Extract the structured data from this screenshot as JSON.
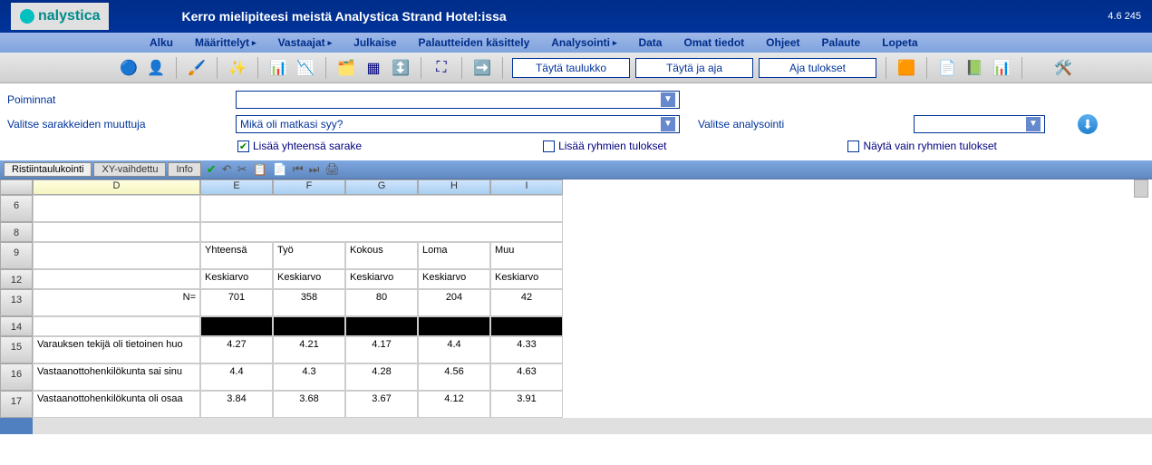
{
  "logo": "nalystica",
  "title": "Kerro mielipiteesi meistä Analystica Strand Hotel:issa",
  "version": "4.6 245",
  "menu": [
    "Alku",
    "Määrittelyt",
    "Vastaajat",
    "Julkaise",
    "Palautteiden käsittely",
    "Analysointi",
    "Data",
    "Omat tiedot",
    "Ohjeet",
    "Palaute",
    "Lopeta"
  ],
  "menu_has_arrow": [
    false,
    true,
    true,
    false,
    false,
    true,
    false,
    false,
    false,
    false,
    false
  ],
  "buttons": {
    "fill": "Täytä taulukko",
    "fillrun": "Täytä ja aja",
    "run": "Aja tulokset"
  },
  "filters": {
    "poiminnat_label": "Poiminnat",
    "poiminnat_value": "",
    "cols_label": "Valitse sarakkeiden muuttuja",
    "cols_value": "Mikä oli matkasi syy?",
    "analysis_label": "Valitse analysointi",
    "analysis_value": ""
  },
  "checks": {
    "total": "Lisää yhteensä sarake",
    "groups": "Lisää ryhmien tulokset",
    "only": "Näytä vain ryhmien tulokset"
  },
  "tabs": {
    "crosstab": "Ristiintaulukointi",
    "xy": "XY-vaihdettu",
    "info": "Info"
  },
  "sheet": {
    "cols": [
      "D",
      "E",
      "F",
      "G",
      "H",
      "I"
    ],
    "row_nums": [
      "6",
      "8",
      "9",
      "12",
      "13",
      "14",
      "15",
      "16",
      "17"
    ],
    "headers_row": [
      "",
      "Yhteensä",
      "Työ",
      "Kokous",
      "Loma",
      "Muu"
    ],
    "avg_row": [
      "",
      "Keskiarvo",
      "Keskiarvo",
      "Keskiarvo",
      "Keskiarvo",
      "Keskiarvo"
    ],
    "n_label": "N=",
    "n_row": [
      "701",
      "358",
      "80",
      "204",
      "42"
    ],
    "data": [
      {
        "label": "Varauksen tekijä oli tietoinen huo",
        "vals": [
          "4.27",
          "4.21",
          "4.17",
          "4.4",
          "4.33"
        ]
      },
      {
        "label": "Vastaanottohenkilökunta sai sinu",
        "vals": [
          "4.4",
          "4.3",
          "4.28",
          "4.56",
          "4.63"
        ]
      },
      {
        "label": "Vastaanottohenkilökunta oli osaa",
        "vals": [
          "3.84",
          "3.68",
          "3.67",
          "4.12",
          "3.91"
        ]
      }
    ]
  },
  "chart_data": {
    "type": "table",
    "title": "Ristiintaulukointi — Keskiarvo",
    "column_variable": "Mikä oli matkasi syy?",
    "categories": [
      "Yhteensä",
      "Työ",
      "Kokous",
      "Loma",
      "Muu"
    ],
    "n": [
      701,
      358,
      80,
      204,
      42
    ],
    "series": [
      {
        "name": "Varauksen tekijä oli tietoinen huo",
        "values": [
          4.27,
          4.21,
          4.17,
          4.4,
          4.33
        ]
      },
      {
        "name": "Vastaanottohenkilökunta sai sinu",
        "values": [
          4.4,
          4.3,
          4.28,
          4.56,
          4.63
        ]
      },
      {
        "name": "Vastaanottohenkilökunta oli osaa",
        "values": [
          3.84,
          3.68,
          3.67,
          4.12,
          3.91
        ]
      }
    ]
  }
}
